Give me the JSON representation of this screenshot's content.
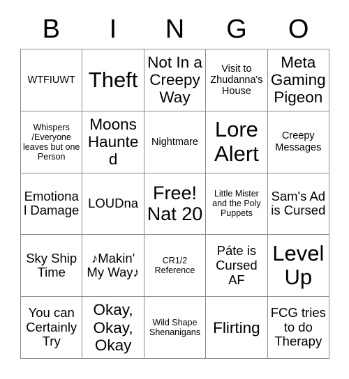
{
  "card": {
    "header_letters": [
      "B",
      "I",
      "N",
      "G",
      "O"
    ],
    "colors": {
      "background": "#ffffff",
      "text": "#000000",
      "grid_line": "#8a8a8a"
    },
    "grid": {
      "columns": 5,
      "rows": 5,
      "cells": [
        {
          "text": "WTFIUWT",
          "size": "sm"
        },
        {
          "text": "Theft",
          "size": "xxl"
        },
        {
          "text": "Not In a Creepy Way",
          "size": "lg"
        },
        {
          "text": "Visit to Zhudanna's House",
          "size": "sm"
        },
        {
          "text": "Meta Gaming Pigeon",
          "size": "lg"
        },
        {
          "text": "Whispers /Everyone leaves but one Person",
          "size": "xs"
        },
        {
          "text": "Moons Haunted",
          "size": "lg"
        },
        {
          "text": "Nightmare",
          "size": "sm"
        },
        {
          "text": "Lore Alert",
          "size": "xxl"
        },
        {
          "text": "Creepy Messages",
          "size": "sm"
        },
        {
          "text": "Emotional Damage",
          "size": "md"
        },
        {
          "text": "LOUDna",
          "size": "md"
        },
        {
          "text": "Free! Nat 20",
          "size": "xl"
        },
        {
          "text": "Little Mister and the Poly Puppets",
          "size": "xs"
        },
        {
          "text": "Sam's Ad is Cursed",
          "size": "md"
        },
        {
          "text": "Sky Ship Time",
          "size": "md"
        },
        {
          "text": "♪Makin' My Way♪",
          "size": "md"
        },
        {
          "text": "CR1/2 Reference",
          "size": "xs"
        },
        {
          "text": "Páte is Cursed AF",
          "size": "md"
        },
        {
          "text": "Level Up",
          "size": "xxl"
        },
        {
          "text": "You can Certainly Try",
          "size": "md"
        },
        {
          "text": "Okay, Okay, Okay",
          "size": "lg"
        },
        {
          "text": "Wild Shape Shenanigans",
          "size": "xs"
        },
        {
          "text": "Flirting",
          "size": "lg"
        },
        {
          "text": "FCG tries to do Therapy",
          "size": "md"
        }
      ]
    }
  }
}
